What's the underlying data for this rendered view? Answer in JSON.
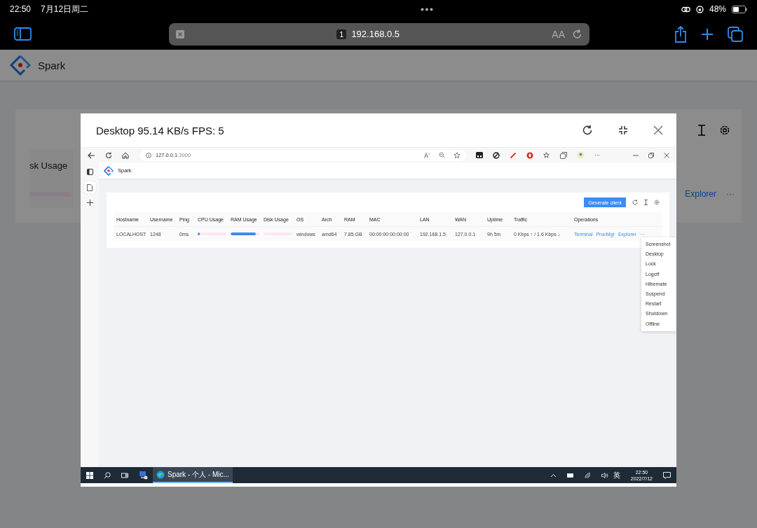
{
  "status_bar": {
    "time": "22:50",
    "date": "7月12日周二",
    "battery": "48%"
  },
  "safari": {
    "tab_count": "1",
    "address": "192.168.0.5",
    "text_size_button": "AA"
  },
  "app": {
    "brand": "Spark",
    "table_column": "sk Usage",
    "link": "Explorer",
    "more": "···"
  },
  "dialog": {
    "title": "Desktop 95.14 KB/s FPS: 5",
    "remote_screen": {
      "browser": {
        "host": "127.0.0.1",
        "port": ":3000",
        "more": "···"
      },
      "brand": "Spark",
      "generate_button": "Generate client",
      "columns": [
        "Hostname",
        "Username",
        "Ping",
        "CPU Usage",
        "RAM Usage",
        "Disk Usage",
        "OS",
        "Arch",
        "RAM",
        "MAC",
        "LAN",
        "WAN",
        "Uptime",
        "Traffic",
        "Operations"
      ],
      "rows": [
        {
          "cells": [
            {
              "kind": "text",
              "text": "LOCALHOST"
            },
            {
              "kind": "text",
              "text": "1248"
            },
            {
              "kind": "text",
              "text": "0ms"
            },
            {
              "kind": "meter",
              "level": 0.08
            },
            {
              "kind": "meter",
              "level": 0.88
            },
            {
              "kind": "meter"
            },
            {
              "kind": "text",
              "text": "windows"
            },
            {
              "kind": "text",
              "text": "amd64"
            },
            {
              "kind": "text",
              "text": "7.85 GB"
            },
            {
              "kind": "text",
              "text": "00:00:00:00:00:00"
            },
            {
              "kind": "text",
              "text": "192.168.1.5"
            },
            {
              "kind": "text",
              "text": "127.0.0.1"
            },
            {
              "kind": "text",
              "text": "9h 5m"
            },
            {
              "kind": "text",
              "text": "0 Kbps ↑ / 1.6 Kbps ↓"
            },
            {
              "kind": "actions",
              "links": [
                "Terminal",
                "ProcMgr",
                "Explorer"
              ],
              "more": "···"
            }
          ]
        }
      ],
      "menu": [
        "Screenshot",
        "Desktop",
        "Lock",
        "Logoff",
        "Hibernate",
        "Suspend",
        "Restart",
        "Shutdown",
        "Offline"
      ],
      "taskbar": {
        "task": "Spark - 个人 - Mic...",
        "ime": "英",
        "time": "22:50",
        "date": "2022/7/12"
      }
    }
  }
}
